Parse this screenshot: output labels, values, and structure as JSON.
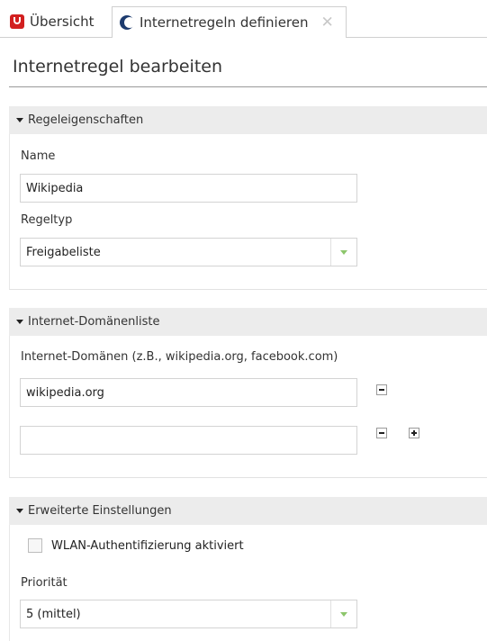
{
  "tabs": [
    {
      "label": "Übersicht"
    },
    {
      "label": "Internetregeln definieren"
    }
  ],
  "page": {
    "title": "Internetregel bearbeiten"
  },
  "rule_properties": {
    "header": "Regeleigenschaften",
    "name_label": "Name",
    "name_value": "Wikipedia",
    "type_label": "Regeltyp",
    "type_value": "Freigabeliste"
  },
  "domain_list": {
    "header": "Internet-Domänenliste",
    "label": "Internet-Domänen (z.B., wikipedia.org, facebook.com)",
    "entries": [
      "wikipedia.org",
      ""
    ]
  },
  "advanced": {
    "header": "Erweiterte Einstellungen",
    "wlan_auth_label": "WLAN-Authentifizierung aktiviert",
    "wlan_auth_checked": false,
    "priority_label": "Priorität",
    "priority_value": "5 (mittel)"
  },
  "colors": {
    "accent_green": "#8dc66c",
    "brand_red": "#d21f1f",
    "section_bg": "#ececec"
  }
}
